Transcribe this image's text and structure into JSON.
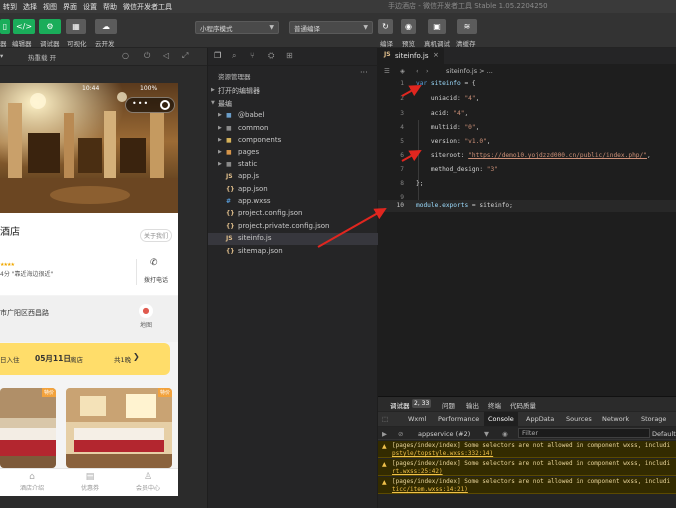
{
  "menubar": {
    "items": [
      "转到",
      "选择",
      "视图",
      "界面",
      "设置",
      "帮助",
      "微信开发者工具"
    ],
    "window_title": "手边酒店 - 微信开发者工具 Stable 1.05.2204250"
  },
  "toolbar": {
    "left_labels": [
      "器",
      "编辑器",
      "调试器",
      "可视化",
      "云开发"
    ],
    "mode_select": "小程序模式",
    "compile_select": "普通编译",
    "right_labels": [
      "编译",
      "预览",
      "真机调试",
      "清缓存"
    ]
  },
  "simulator": {
    "bar_label": "热重载 开",
    "status_time": "10:44",
    "battery": "100%",
    "hotel_name": "酒店",
    "about_label": "关于我们",
    "score_text": "4分 \"靠近海边很近\"",
    "call_label": "拨打电话",
    "address": "市广阳区西昌路",
    "map_label": "地图",
    "checkin_label": "日入住",
    "date": "05月11日",
    "checkout_label": "离店",
    "nights": "共1晚",
    "room_tag": "特价",
    "tabs": [
      "酒店介绍",
      "优惠券",
      "会员中心"
    ],
    "colors": {
      "accent_yellow": "#ffdd6a",
      "tag_orange": "#f2a23c"
    }
  },
  "explorer": {
    "header": "资源管理器",
    "open_editors": "打开的编辑器",
    "project": "最编",
    "items": [
      {
        "name": "@babel",
        "type": "folder"
      },
      {
        "name": "common",
        "type": "folder"
      },
      {
        "name": "components",
        "type": "folder"
      },
      {
        "name": "pages",
        "type": "folder"
      },
      {
        "name": "static",
        "type": "folder"
      },
      {
        "name": "app.js",
        "type": "js"
      },
      {
        "name": "app.json",
        "type": "json"
      },
      {
        "name": "app.wxss",
        "type": "wxss"
      },
      {
        "name": "project.config.json",
        "type": "json"
      },
      {
        "name": "project.private.config.json",
        "type": "json"
      },
      {
        "name": "siteinfo.js",
        "type": "js",
        "selected": true
      },
      {
        "name": "sitemap.json",
        "type": "json"
      }
    ]
  },
  "editor": {
    "tab_name": "siteinfo.js",
    "breadcrumb": "siteinfo.js > ...",
    "current_line": 10
  },
  "devtools": {
    "top_tab": "调试器",
    "badge": "2, 33",
    "top_tabs": [
      "问题",
      "输出",
      "终端",
      "代码质量"
    ],
    "tabs": [
      "Wxml",
      "Performance",
      "Console",
      "AppData",
      "Sources",
      "Network",
      "Storage"
    ],
    "active_tab": "Console",
    "context": "appservice (#2)",
    "filter_placeholder": "Filter",
    "level": "Default",
    "logs": [
      {
        "text": "[pages/index/index] Some selectors are not allowed in component wxss, includi",
        "src": "pstyle/topstyle.wxss:332:14)"
      },
      {
        "text": "[pages/index/index] Some selectors are not allowed in component wxss, includi",
        "src": "rt.wxss:25:42)"
      },
      {
        "text": "[pages/index/index] Some selectors are not allowed in component wxss, includi",
        "src": "ticc/item.wxss:14:21)"
      }
    ]
  }
}
